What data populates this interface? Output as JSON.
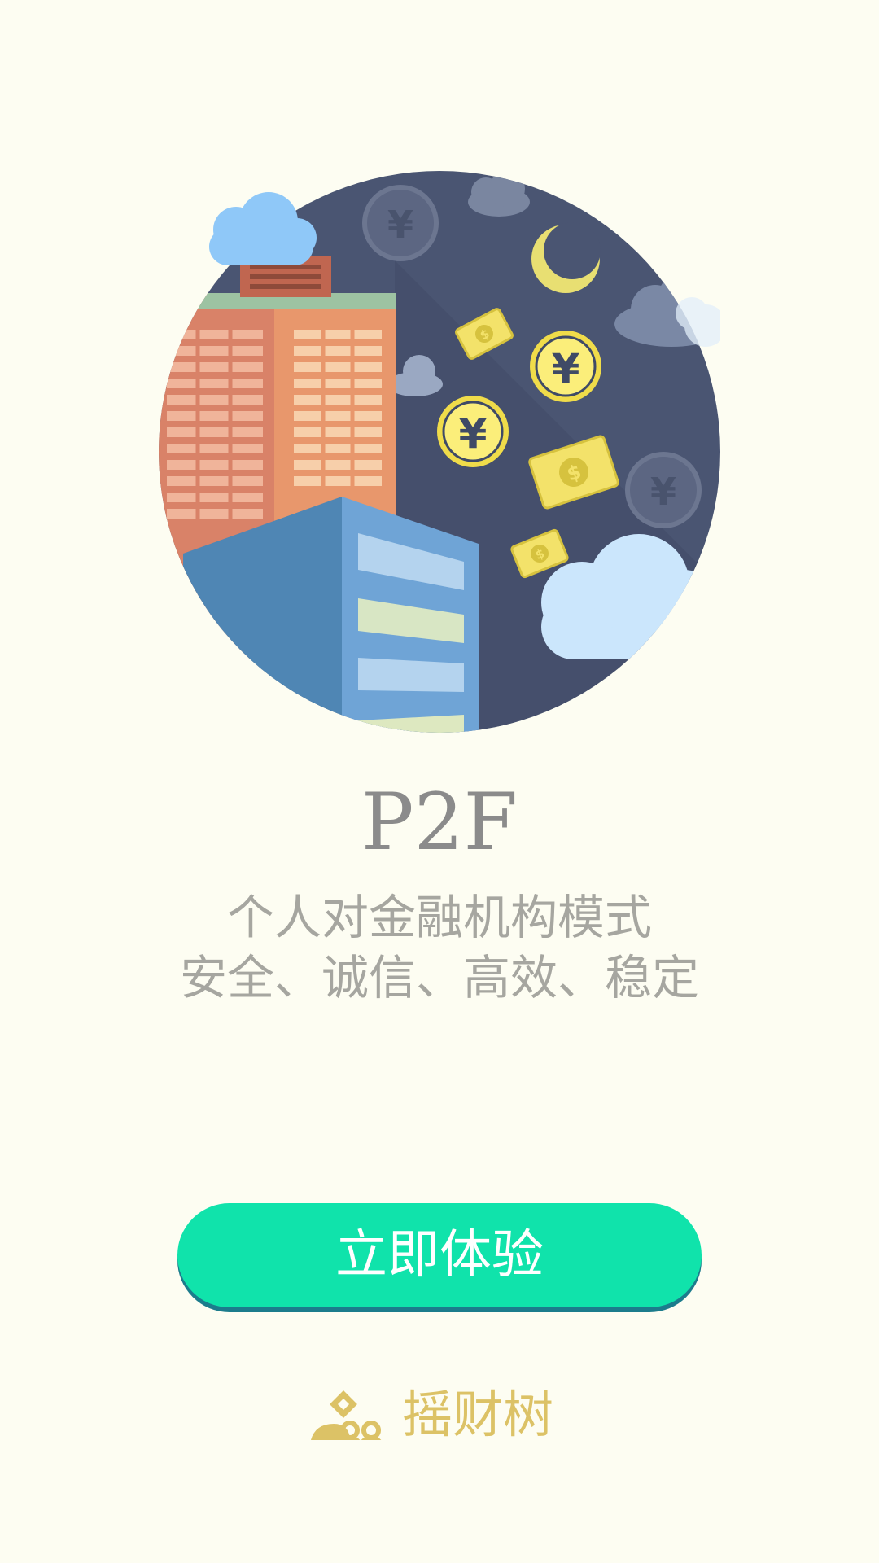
{
  "colors": {
    "background": "#fdfdf2",
    "cta_button": "#10e3ab",
    "cta_shadow": "#1c7c8c",
    "title_text": "#8b8b8b",
    "tagline_text": "#a6a6a0",
    "logo_gold": "#dcc266",
    "night_sky": "#4a5572"
  },
  "hero": {
    "illustration": "city-finance-illustration",
    "icons": [
      "building-icon",
      "yuan-coin-icon",
      "money-bill-icon",
      "moon-icon",
      "cloud-icon"
    ]
  },
  "brand": {
    "title": "P2F"
  },
  "tagline": {
    "line1": "个人对金融机构模式",
    "line2": "安全、诚信、高效、稳定"
  },
  "cta": {
    "label": "立即体验"
  },
  "footer": {
    "logo_text": "摇财树",
    "logo_icon": "people-logo-icon"
  }
}
